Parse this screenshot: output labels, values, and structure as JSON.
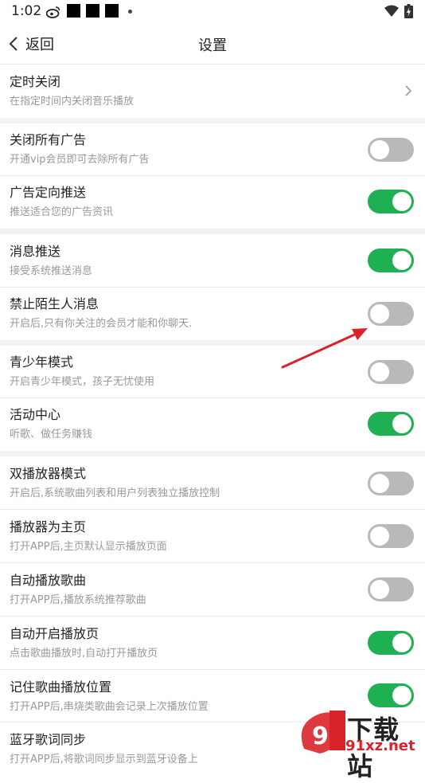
{
  "status_bar": {
    "time": "1:02"
  },
  "nav": {
    "back_label": "返回",
    "title": "设置"
  },
  "settings": [
    {
      "title": "定时关闭",
      "subtitle": "在指定时间内关闭音乐播放",
      "control": "chevron"
    },
    {
      "title": "关闭所有广告",
      "subtitle": "开通vip会员即可去除所有广告",
      "control": "toggle",
      "on": false
    },
    {
      "title": "广告定向推送",
      "subtitle": "推送适合您的广告资讯",
      "control": "toggle",
      "on": true
    },
    {
      "title": "消息推送",
      "subtitle": "接受系统推送消息",
      "control": "toggle",
      "on": true
    },
    {
      "title": "禁止陌生人消息",
      "subtitle": "开启后,只有你关注的会员才能和你聊天.",
      "control": "toggle",
      "on": false
    },
    {
      "title": "青少年模式",
      "subtitle": "开启青少年模式，孩子无忧使用",
      "control": "toggle",
      "on": false
    },
    {
      "title": "活动中心",
      "subtitle": "听歌、做任务赚钱",
      "control": "toggle",
      "on": true
    },
    {
      "title": "双播放器模式",
      "subtitle": "开启后,系统歌曲列表和用户列表独立播放控制",
      "control": "toggle",
      "on": false
    },
    {
      "title": "播放器为主页",
      "subtitle": "打开APP后,主页默认显示播放页面",
      "control": "toggle",
      "on": false
    },
    {
      "title": "自动播放歌曲",
      "subtitle": "打开APP后,播放系统推荐歌曲",
      "control": "toggle",
      "on": false
    },
    {
      "title": "自动开启播放页",
      "subtitle": "点击歌曲播放时,自动打开播放页",
      "control": "toggle",
      "on": true
    },
    {
      "title": "记住歌曲播放位置",
      "subtitle": "打开APP后,串烧类歌曲会记录上次播放位置",
      "control": "toggle",
      "on": true
    },
    {
      "title": "蓝牙歌词同步",
      "subtitle": "打开APP后,将歌词同步显示到蓝牙设备上",
      "control": "toggle",
      "on": false
    }
  ],
  "watermark": {
    "text": "下载站",
    "url": "91xz.net"
  },
  "colors": {
    "toggle_on": "#1eb052",
    "toggle_off": "#b9b9b9",
    "arrow": "#d9232a"
  }
}
